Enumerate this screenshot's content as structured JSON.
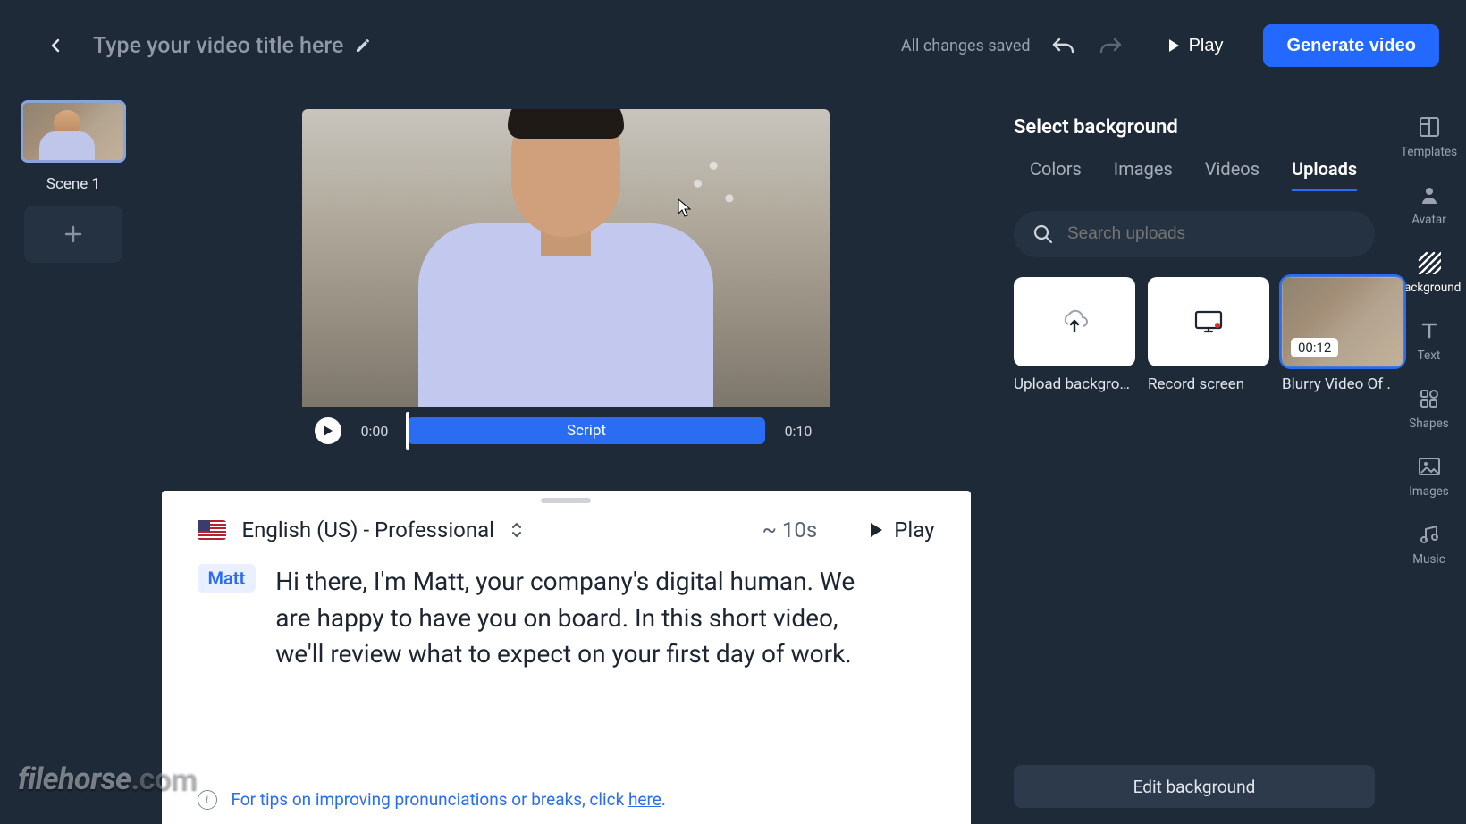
{
  "header": {
    "title_placeholder": "Type your video title here",
    "saved_note": "All changes saved",
    "play_label": "Play",
    "generate_label": "Generate video"
  },
  "scenes": {
    "items": [
      {
        "label": "Scene 1"
      }
    ]
  },
  "player": {
    "start_time": "0:00",
    "end_time": "0:10",
    "segment_label": "Script"
  },
  "script": {
    "language_label": "English (US) - Professional",
    "estimate": "~ 10s",
    "play_label": "Play",
    "speaker": "Matt",
    "text": "Hi there, I'm Matt, your company's digital human.  We are happy to have you on board. In this short video, we'll review what to expect on your first day of work.",
    "tip_prefix": "For tips on improving pronunciations or breaks, click ",
    "tip_link": "here",
    "tip_suffix": "."
  },
  "bgPanel": {
    "title": "Select background",
    "tabs": [
      "Colors",
      "Images",
      "Videos",
      "Uploads"
    ],
    "active_tab": "Uploads",
    "search_placeholder": "Search uploads",
    "tiles": {
      "upload": "Upload background",
      "record": "Record screen",
      "clip_caption": "Blurry Video Of P...",
      "clip_duration": "00:12"
    },
    "edit_label": "Edit background"
  },
  "rail": {
    "items": [
      "Templates",
      "Avatar",
      "Background",
      "Text",
      "Shapes",
      "Images",
      "Music"
    ],
    "active": "Background"
  },
  "watermark": {
    "a": "filehorse",
    "b": ".com"
  }
}
